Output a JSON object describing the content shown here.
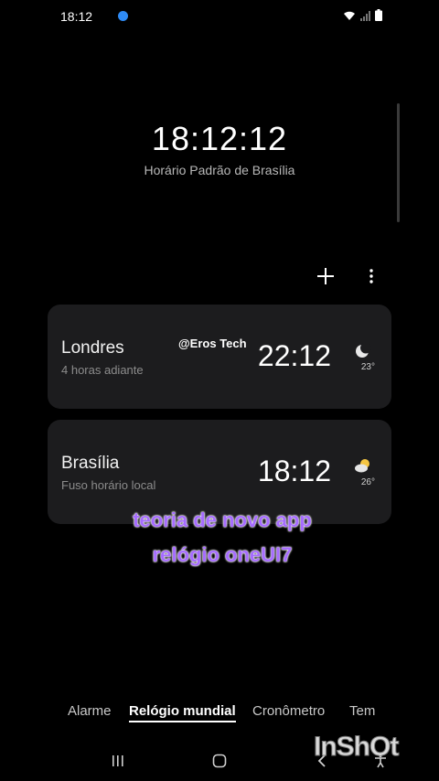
{
  "status_bar": {
    "time": "18:12",
    "icons": [
      "notification-dot-icon",
      "wifi-icon",
      "signal-icon",
      "battery-icon"
    ],
    "dot_color": "#2f8bf5"
  },
  "header": {
    "time": "18:12:12",
    "timezone": "Horário Padrão de Brasília"
  },
  "toolbar": {
    "icons": [
      "plus-icon",
      "more-vert-icon"
    ]
  },
  "clocks": [
    {
      "city": "Londres",
      "subtitle": "4 horas adiante",
      "time": "22:12",
      "weather_icon": "moon-icon",
      "temperature": "23°"
    },
    {
      "city": "Brasília",
      "subtitle": "Fuso horário local",
      "time": "18:12",
      "weather_icon": "partly-cloudy-icon",
      "temperature": "26°"
    }
  ],
  "watermark": "@Eros Tech",
  "caption": {
    "line1": "teoria de novo app",
    "line2": "relógio oneUI7",
    "color": "#a66cff"
  },
  "tabs": [
    {
      "label": "Alarme",
      "active": false
    },
    {
      "label": "Relógio mundial",
      "active": true
    },
    {
      "label": "Cronômetro",
      "active": false
    },
    {
      "label": "Tem",
      "active": false
    }
  ],
  "nav_bar": {
    "icons": [
      "recents-icon",
      "home-icon",
      "back-icon",
      "accessibility-icon"
    ]
  },
  "app_watermark": "InShOt"
}
